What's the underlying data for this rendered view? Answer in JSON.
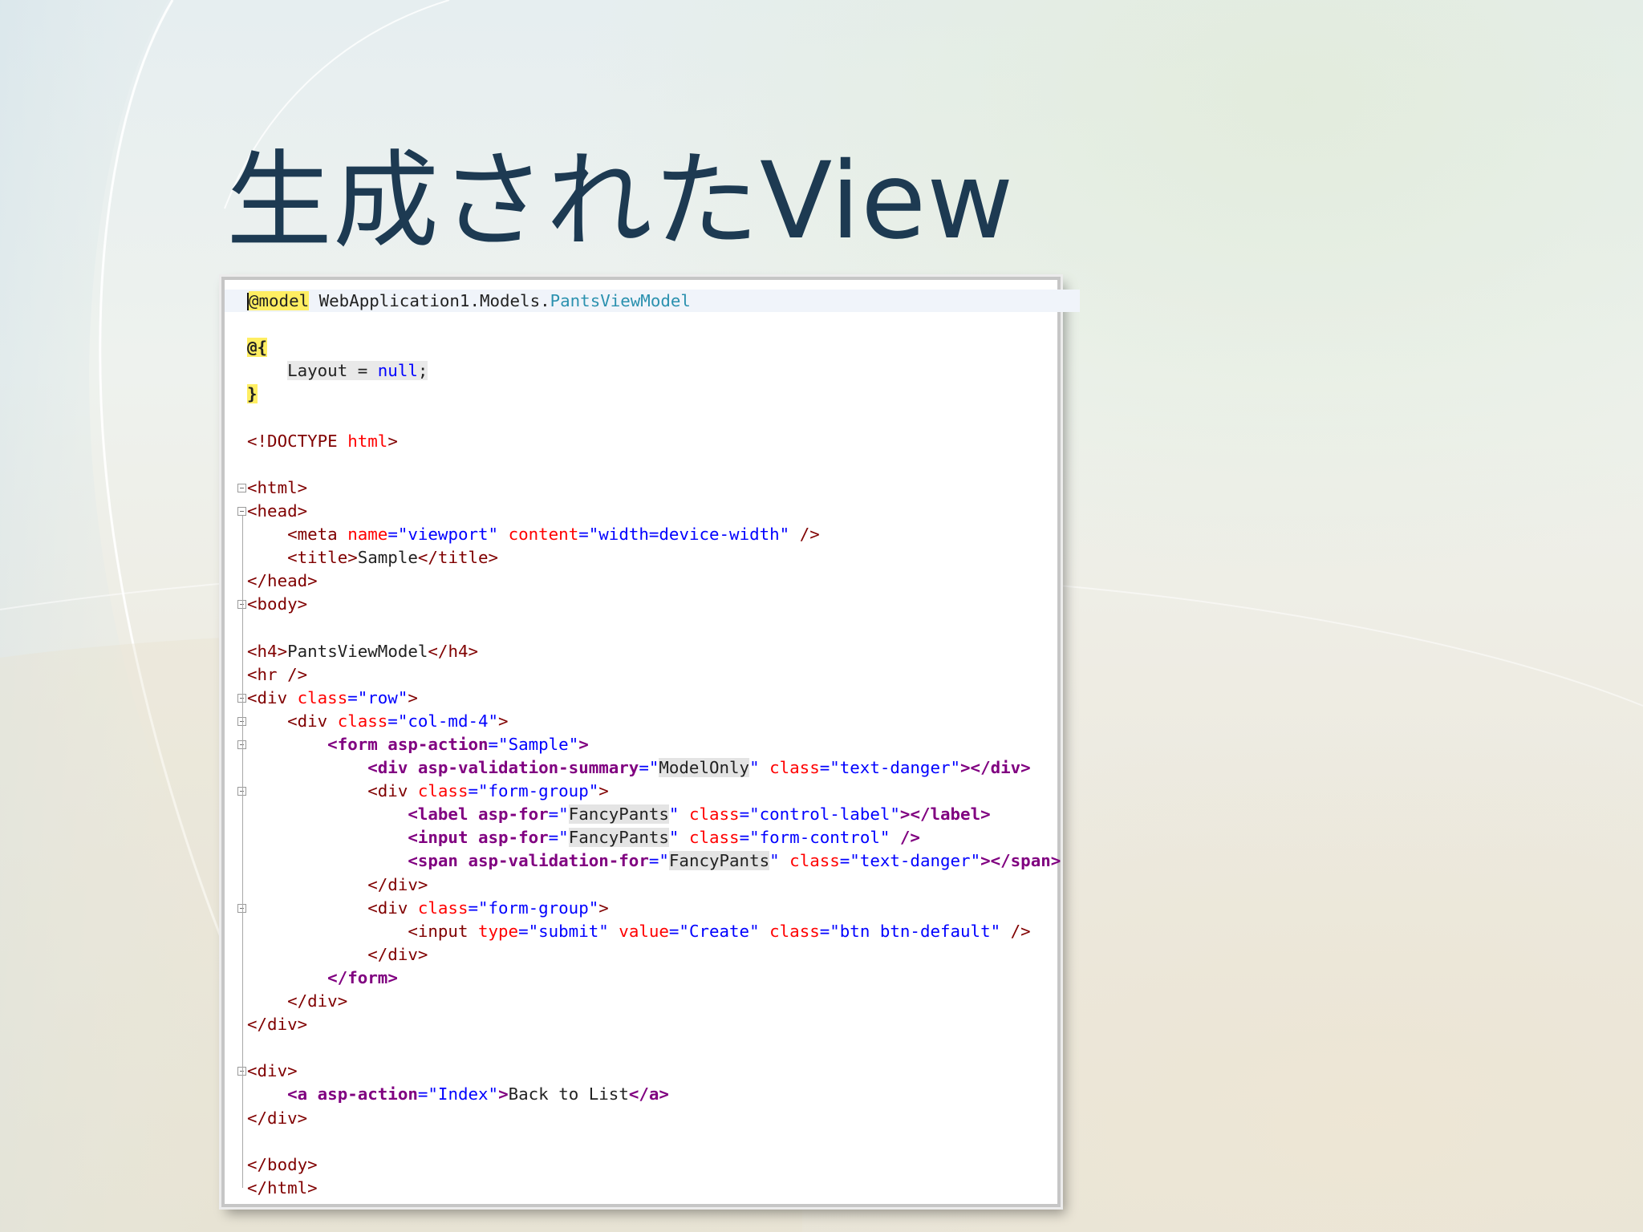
{
  "slide": {
    "title": "生成されたView"
  },
  "code": {
    "lines": [
      {
        "t": 0,
        "fold": null,
        "tokens": [
          [
            "@model",
            "razor"
          ],
          [
            " WebApplication1.Models.",
            "text"
          ],
          [
            "PantsViewModel",
            "type"
          ]
        ]
      },
      {
        "t": 1,
        "fold": null,
        "tokens": []
      },
      {
        "t": 2,
        "fold": null,
        "tokens": [
          [
            "@{",
            "razor-bold"
          ]
        ]
      },
      {
        "t": 3,
        "fold": null,
        "tokens": [
          [
            "    ",
            "text"
          ],
          [
            "Layout = ",
            "var-bg"
          ],
          [
            "null",
            "kw-bg"
          ],
          [
            ";",
            "var-bg"
          ]
        ]
      },
      {
        "t": 4,
        "fold": null,
        "tokens": [
          [
            "}",
            "razor-bold"
          ]
        ]
      },
      {
        "t": 5,
        "fold": null,
        "tokens": []
      },
      {
        "t": 6,
        "fold": null,
        "tokens": [
          [
            "<!",
            "tag"
          ],
          [
            "DOCTYPE",
            "tag"
          ],
          [
            " html",
            "attr"
          ],
          [
            ">",
            "tag"
          ]
        ]
      },
      {
        "t": 7,
        "fold": null,
        "tokens": []
      },
      {
        "t": 8,
        "fold": "box",
        "tokens": [
          [
            "<",
            "tag"
          ],
          [
            "html",
            "tag"
          ],
          [
            ">",
            "tag"
          ]
        ]
      },
      {
        "t": 9,
        "fold": "box",
        "tokens": [
          [
            "<",
            "tag"
          ],
          [
            "head",
            "tag"
          ],
          [
            ">",
            "tag"
          ]
        ]
      },
      {
        "t": 10,
        "fold": null,
        "tokens": [
          [
            "    <",
            "tag"
          ],
          [
            "meta",
            "tag"
          ],
          [
            " name",
            "attr"
          ],
          [
            "=\"",
            "val"
          ],
          [
            "viewport",
            "val"
          ],
          [
            "\"",
            "val"
          ],
          [
            " content",
            "attr"
          ],
          [
            "=\"",
            "val"
          ],
          [
            "width=device-width",
            "val"
          ],
          [
            "\"",
            "val"
          ],
          [
            " />",
            "tag"
          ]
        ]
      },
      {
        "t": 11,
        "fold": null,
        "tokens": [
          [
            "    <",
            "tag"
          ],
          [
            "title",
            "tag"
          ],
          [
            ">",
            "tag"
          ],
          [
            "Sample",
            "text"
          ],
          [
            "</",
            "tag"
          ],
          [
            "title",
            "tag"
          ],
          [
            ">",
            "tag"
          ]
        ]
      },
      {
        "t": 12,
        "fold": null,
        "tokens": [
          [
            "</",
            "tag"
          ],
          [
            "head",
            "tag"
          ],
          [
            ">",
            "tag"
          ]
        ]
      },
      {
        "t": 13,
        "fold": "box",
        "tokens": [
          [
            "<",
            "tag"
          ],
          [
            "body",
            "tag"
          ],
          [
            ">",
            "tag"
          ]
        ]
      },
      {
        "t": 14,
        "fold": null,
        "tokens": []
      },
      {
        "t": 15,
        "fold": null,
        "tokens": [
          [
            "<",
            "tag"
          ],
          [
            "h4",
            "tag"
          ],
          [
            ">",
            "tag"
          ],
          [
            "PantsViewModel",
            "text"
          ],
          [
            "</",
            "tag"
          ],
          [
            "h4",
            "tag"
          ],
          [
            ">",
            "tag"
          ]
        ]
      },
      {
        "t": 16,
        "fold": null,
        "tokens": [
          [
            "<",
            "tag"
          ],
          [
            "hr",
            "tag"
          ],
          [
            " />",
            "tag"
          ]
        ]
      },
      {
        "t": 17,
        "fold": "box",
        "tokens": [
          [
            "<",
            "tag"
          ],
          [
            "div",
            "tag"
          ],
          [
            " class",
            "attr"
          ],
          [
            "=\"",
            "val"
          ],
          [
            "row",
            "val"
          ],
          [
            "\"",
            "val"
          ],
          [
            ">",
            "tag"
          ]
        ]
      },
      {
        "t": 18,
        "fold": "box",
        "tokens": [
          [
            "    <",
            "tag"
          ],
          [
            "div",
            "tag"
          ],
          [
            " class",
            "attr"
          ],
          [
            "=\"",
            "val"
          ],
          [
            "col-md-4",
            "val"
          ],
          [
            "\"",
            "val"
          ],
          [
            ">",
            "tag"
          ]
        ]
      },
      {
        "t": 19,
        "fold": "box",
        "tokens": [
          [
            "        <",
            "tag-helper"
          ],
          [
            "form",
            "tag-helper"
          ],
          [
            " asp-action",
            "attr-helper"
          ],
          [
            "=\"",
            "val"
          ],
          [
            "Sample",
            "val"
          ],
          [
            "\"",
            "val"
          ],
          [
            ">",
            "tag-helper"
          ]
        ]
      },
      {
        "t": 20,
        "fold": null,
        "tokens": [
          [
            "            <",
            "tag-helper"
          ],
          [
            "div",
            "tag-helper"
          ],
          [
            " asp-validation-summary",
            "attr-helper"
          ],
          [
            "=\"",
            "val"
          ],
          [
            "ModelOnly",
            "model-val"
          ],
          [
            "\"",
            "val"
          ],
          [
            " class",
            "attr"
          ],
          [
            "=\"",
            "val"
          ],
          [
            "text-danger",
            "val"
          ],
          [
            "\"",
            "val"
          ],
          [
            "></",
            "tag-helper"
          ],
          [
            "div",
            "tag-helper"
          ],
          [
            ">",
            "tag-helper"
          ]
        ]
      },
      {
        "t": 21,
        "fold": "box",
        "tokens": [
          [
            "            <",
            "tag"
          ],
          [
            "div",
            "tag"
          ],
          [
            " class",
            "attr"
          ],
          [
            "=\"",
            "val"
          ],
          [
            "form-group",
            "val"
          ],
          [
            "\"",
            "val"
          ],
          [
            ">",
            "tag"
          ]
        ]
      },
      {
        "t": 22,
        "fold": null,
        "tokens": [
          [
            "                <",
            "tag-helper"
          ],
          [
            "label",
            "tag-helper"
          ],
          [
            " asp-for",
            "attr-helper"
          ],
          [
            "=\"",
            "val"
          ],
          [
            "FancyPants",
            "model-val"
          ],
          [
            "\"",
            "val"
          ],
          [
            " class",
            "attr"
          ],
          [
            "=\"",
            "val"
          ],
          [
            "control-label",
            "val"
          ],
          [
            "\"",
            "val"
          ],
          [
            "></",
            "tag-helper"
          ],
          [
            "label",
            "tag-helper"
          ],
          [
            ">",
            "tag-helper"
          ]
        ]
      },
      {
        "t": 23,
        "fold": null,
        "tokens": [
          [
            "                <",
            "tag-helper"
          ],
          [
            "input",
            "tag-helper"
          ],
          [
            " asp-for",
            "attr-helper"
          ],
          [
            "=\"",
            "val"
          ],
          [
            "FancyPants",
            "model-val"
          ],
          [
            "\"",
            "val"
          ],
          [
            " class",
            "attr"
          ],
          [
            "=\"",
            "val"
          ],
          [
            "form-control",
            "val"
          ],
          [
            "\"",
            "val"
          ],
          [
            " />",
            "tag-helper"
          ]
        ]
      },
      {
        "t": 24,
        "fold": null,
        "tokens": [
          [
            "                <",
            "tag-helper"
          ],
          [
            "span",
            "tag-helper"
          ],
          [
            " asp-validation-for",
            "attr-helper"
          ],
          [
            "=\"",
            "val"
          ],
          [
            "FancyPants",
            "model-val"
          ],
          [
            "\"",
            "val"
          ],
          [
            " class",
            "attr"
          ],
          [
            "=\"",
            "val"
          ],
          [
            "text-danger",
            "val"
          ],
          [
            "\"",
            "val"
          ],
          [
            "></",
            "tag-helper"
          ],
          [
            "span",
            "tag-helper"
          ],
          [
            ">",
            "tag-helper"
          ]
        ]
      },
      {
        "t": 25,
        "fold": null,
        "tokens": [
          [
            "            </",
            "tag"
          ],
          [
            "div",
            "tag"
          ],
          [
            ">",
            "tag"
          ]
        ]
      },
      {
        "t": 26,
        "fold": "box",
        "tokens": [
          [
            "            <",
            "tag"
          ],
          [
            "div",
            "tag"
          ],
          [
            " class",
            "attr"
          ],
          [
            "=\"",
            "val"
          ],
          [
            "form-group",
            "val"
          ],
          [
            "\"",
            "val"
          ],
          [
            ">",
            "tag"
          ]
        ]
      },
      {
        "t": 27,
        "fold": null,
        "tokens": [
          [
            "                <",
            "tag"
          ],
          [
            "input",
            "tag"
          ],
          [
            " type",
            "attr"
          ],
          [
            "=\"",
            "val"
          ],
          [
            "submit",
            "val"
          ],
          [
            "\"",
            "val"
          ],
          [
            " value",
            "attr"
          ],
          [
            "=\"",
            "val"
          ],
          [
            "Create",
            "val"
          ],
          [
            "\"",
            "val"
          ],
          [
            " class",
            "attr"
          ],
          [
            "=\"",
            "val"
          ],
          [
            "btn btn-default",
            "val"
          ],
          [
            "\"",
            "val"
          ],
          [
            " />",
            "tag"
          ]
        ]
      },
      {
        "t": 28,
        "fold": null,
        "tokens": [
          [
            "            </",
            "tag"
          ],
          [
            "div",
            "tag"
          ],
          [
            ">",
            "tag"
          ]
        ]
      },
      {
        "t": 29,
        "fold": null,
        "tokens": [
          [
            "        </",
            "tag-helper"
          ],
          [
            "form",
            "tag-helper"
          ],
          [
            ">",
            "tag-helper"
          ]
        ]
      },
      {
        "t": 30,
        "fold": null,
        "tokens": [
          [
            "    </",
            "tag"
          ],
          [
            "div",
            "tag"
          ],
          [
            ">",
            "tag"
          ]
        ]
      },
      {
        "t": 31,
        "fold": null,
        "tokens": [
          [
            "</",
            "tag"
          ],
          [
            "div",
            "tag"
          ],
          [
            ">",
            "tag"
          ]
        ]
      },
      {
        "t": 32,
        "fold": null,
        "tokens": []
      },
      {
        "t": 33,
        "fold": "box",
        "tokens": [
          [
            "<",
            "tag"
          ],
          [
            "div",
            "tag"
          ],
          [
            ">",
            "tag"
          ]
        ]
      },
      {
        "t": 34,
        "fold": null,
        "tokens": [
          [
            "    <",
            "tag-helper"
          ],
          [
            "a",
            "tag-helper"
          ],
          [
            " asp-action",
            "attr-helper"
          ],
          [
            "=\"",
            "val"
          ],
          [
            "Index",
            "val"
          ],
          [
            "\"",
            "val"
          ],
          [
            ">",
            "tag-helper"
          ],
          [
            "Back to List",
            "text"
          ],
          [
            "</",
            "tag-helper"
          ],
          [
            "a",
            "tag-helper"
          ],
          [
            ">",
            "tag-helper"
          ]
        ]
      },
      {
        "t": 35,
        "fold": null,
        "tokens": [
          [
            "</",
            "tag"
          ],
          [
            "div",
            "tag"
          ],
          [
            ">",
            "tag"
          ]
        ]
      },
      {
        "t": 36,
        "fold": null,
        "tokens": []
      },
      {
        "t": 37,
        "fold": null,
        "tokens": [
          [
            "</",
            "tag"
          ],
          [
            "body",
            "tag"
          ],
          [
            ">",
            "tag"
          ]
        ]
      },
      {
        "t": 38,
        "fold": null,
        "tokens": [
          [
            "</",
            "tag"
          ],
          [
            "html",
            "tag"
          ],
          [
            ">",
            "tag"
          ]
        ]
      }
    ]
  },
  "colors": {
    "title": "#1d3a52",
    "razor_highlight": "#ffee62",
    "type": "#2b91af",
    "keyword": "#0000ff",
    "tag": "#800000",
    "tag_helper": "#800080",
    "attribute": "#ff0000",
    "value": "#0000ff"
  }
}
